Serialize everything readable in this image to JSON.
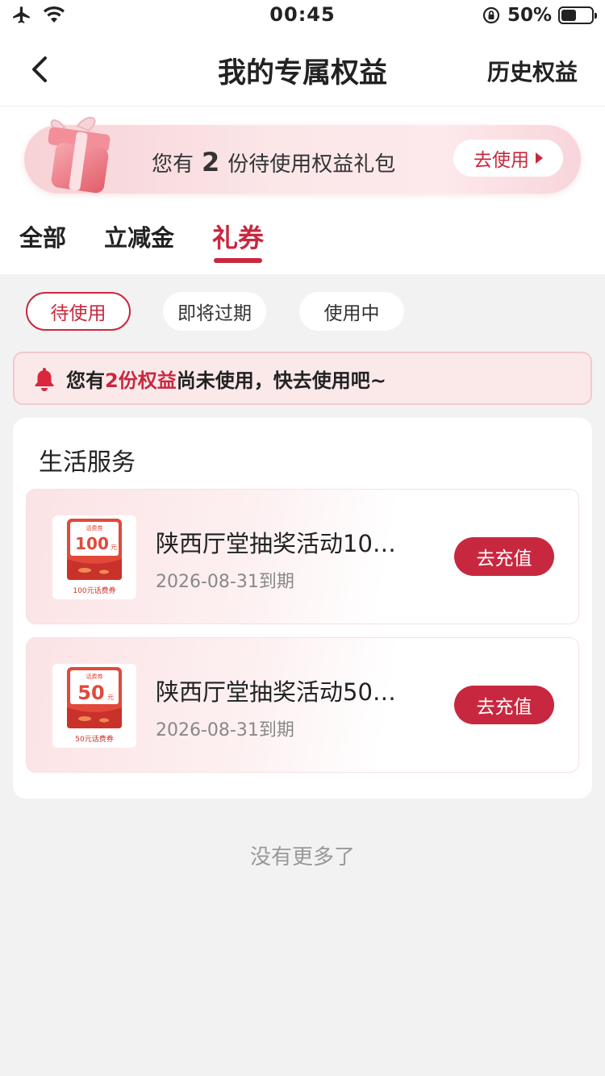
{
  "status_bar": {
    "time": "00:45",
    "battery_percent": "50%",
    "battery_level": 0.5,
    "icons": [
      "airplane-icon",
      "wifi-icon",
      "rotation-lock-icon",
      "battery-icon"
    ]
  },
  "header": {
    "title": "我的专属权益",
    "right_action": "历史权益",
    "back_icon": "chevron-left-icon"
  },
  "banner": {
    "prefix": "您有",
    "count": "2",
    "suffix": "份待使用权益礼包",
    "button_label": "去使用",
    "icon": "gift-box-icon"
  },
  "tabs": [
    {
      "label": "全部"
    },
    {
      "label": "立减金"
    },
    {
      "label": "礼券",
      "active": true
    }
  ],
  "filters": [
    {
      "label": "待使用",
      "active": true
    },
    {
      "label": "即将过期"
    },
    {
      "label": "使用中"
    }
  ],
  "notice": {
    "prefix": "您有",
    "highlight": "2份权益",
    "suffix": "尚未使用，快去使用吧~",
    "icon": "bell-icon"
  },
  "section": {
    "title": "生活服务",
    "items": [
      {
        "name": "陕西厅堂抽奖活动10…",
        "expiry": "2026-08-31到期",
        "button": "去充值",
        "thumb": {
          "top_label": "话费券",
          "amount": "100",
          "unit": "元",
          "caption": "100元话费券"
        }
      },
      {
        "name": "陕西厅堂抽奖活动50…",
        "expiry": "2026-08-31到期",
        "button": "去充值",
        "thumb": {
          "top_label": "话费券",
          "amount": "50",
          "unit": "元",
          "caption": "50元话费券"
        }
      }
    ]
  },
  "footer": {
    "no_more": "没有更多了"
  },
  "colors": {
    "accent": "#c8283f",
    "background": "#f2f2f2",
    "notice_bg": "#fbe9ea"
  }
}
